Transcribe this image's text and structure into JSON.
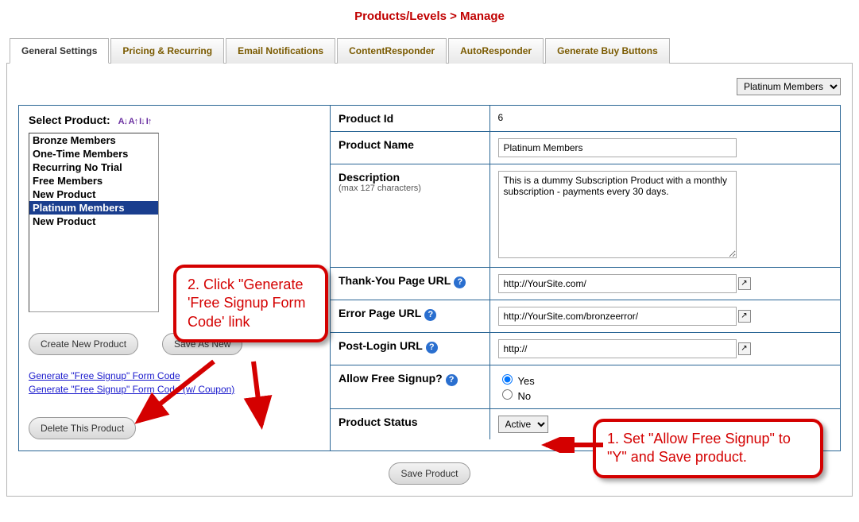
{
  "page_title": "Products/Levels > Manage",
  "tabs": {
    "general": "General Settings",
    "pricing": "Pricing & Recurring",
    "email": "Email Notifications",
    "content": "ContentResponder",
    "auto": "AutoResponder",
    "buy": "Generate Buy Buttons"
  },
  "top_product_select": "Platinum Members",
  "select_product_label": "Select Product:",
  "sort_glyph": "A↓ A↑  I↓ I↑",
  "product_list": [
    "Bronze Members",
    "One-Time Members",
    "Recurring No Trial",
    "Free Members",
    "New Product",
    "Platinum Members",
    "New Product"
  ],
  "selected_index": 5,
  "buttons": {
    "create": "Create New Product",
    "saveas": "Save As New",
    "delete": "Delete This Product",
    "save": "Save Product"
  },
  "links": {
    "gen1": "Generate \"Free Signup\" Form Code",
    "gen2": "Generate \"Free Signup\" Form Code (w/ Coupon)"
  },
  "fields": {
    "product_id_label": "Product Id",
    "product_id_value": "6",
    "product_name_label": "Product Name",
    "product_name_value": "Platinum Members",
    "description_label": "Description",
    "description_hint": "(max 127 characters)",
    "description_value": "This is a dummy Subscription Product with a monthly subscription - payments every 30 days.",
    "thank_url_label": "Thank-You Page URL",
    "thank_url_value": "http://YourSite.com/",
    "error_url_label": "Error Page URL",
    "error_url_value": "http://YourSite.com/bronzeerror/",
    "post_login_label": "Post-Login URL",
    "post_login_value": "http://",
    "allow_free_label": "Allow Free Signup?",
    "allow_free_yes": "Yes",
    "allow_free_no": "No",
    "status_label": "Product Status",
    "status_value": "Active"
  },
  "callouts": {
    "c1": "2. Click \"Generate 'Free Signup Form Code' link",
    "c2": "1. Set \"Allow Free Signup\" to \"Y\" and Save product."
  }
}
